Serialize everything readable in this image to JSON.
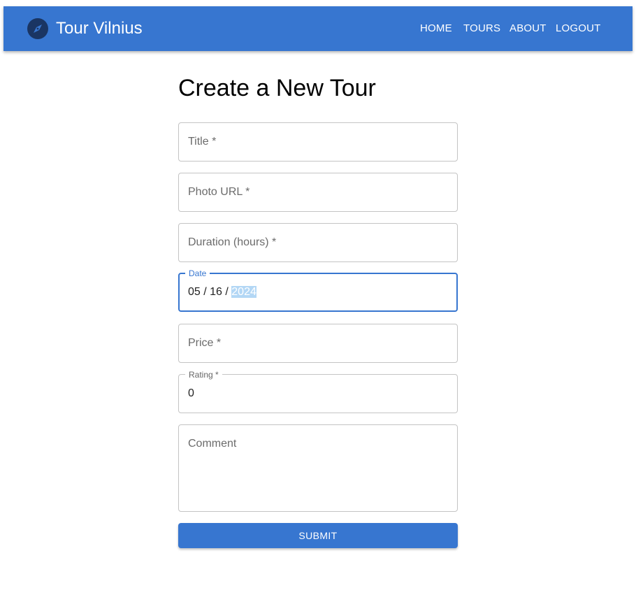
{
  "header": {
    "brand": "Tour Vilnius",
    "nav": [
      "HOME",
      "TOURS",
      "ABOUT",
      "LOGOUT"
    ]
  },
  "page": {
    "title": "Create a New Tour"
  },
  "form": {
    "title_placeholder": "Title *",
    "photo_placeholder": "Photo URL *",
    "duration_placeholder": "Duration (hours) *",
    "date_label": "Date",
    "date_month": "05",
    "date_day": "16",
    "date_sep": " / ",
    "date_year": "2024",
    "price_placeholder": "Price *",
    "rating_label": "Rating *",
    "rating_value": "0",
    "comment_placeholder": "Comment",
    "submit_label": "SUBMIT"
  },
  "colors": {
    "primary": "#3776d0",
    "selection": "#b3d7f5"
  },
  "icons": {
    "logo": "compass-icon"
  }
}
